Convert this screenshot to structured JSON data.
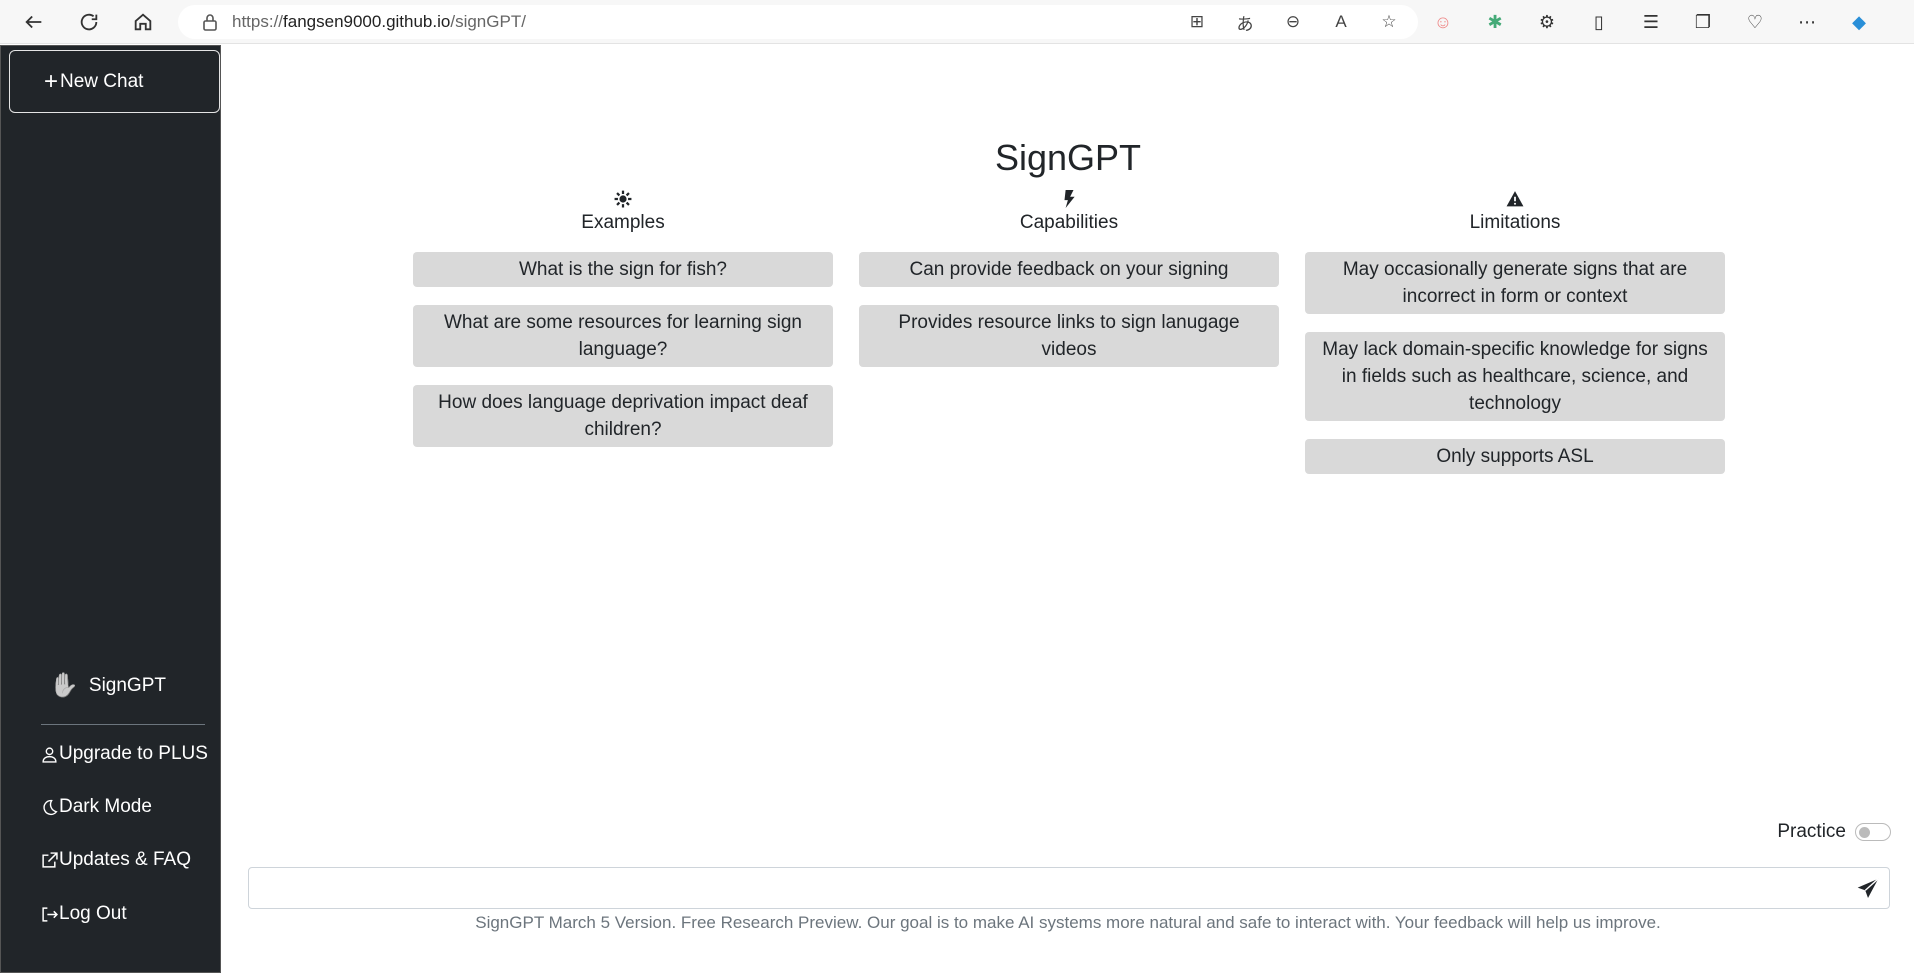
{
  "browser": {
    "url_prefix": "https://",
    "url_host": "fangsen9000.github.io",
    "url_path": "/signGPT/"
  },
  "sidebar": {
    "new_chat": "New Chat",
    "brand": "SignGPT",
    "items": [
      {
        "label": "Upgrade to PLUS",
        "icon": "person-icon"
      },
      {
        "label": "Dark Mode",
        "icon": "moon-icon"
      },
      {
        "label": "Updates & FAQ",
        "icon": "external-link-icon"
      },
      {
        "label": "Log Out",
        "icon": "logout-icon"
      }
    ]
  },
  "main": {
    "title": "SignGPT",
    "columns": [
      {
        "heading": "Examples",
        "icon": "sun-icon",
        "cards": [
          "What is the sign for fish?",
          "What are some resources for learning sign language?",
          "How does language deprivation impact deaf children?"
        ]
      },
      {
        "heading": "Capabilities",
        "icon": "lightning-icon",
        "cards": [
          "Can provide feedback on your signing",
          "Provides resource links to sign lanugage videos"
        ]
      },
      {
        "heading": "Limitations",
        "icon": "warning-icon",
        "cards": [
          "May occasionally generate signs that are incorrect in form or context",
          "May lack domain-specific knowledge for signs in fields such as healthcare, science, and technology",
          "Only supports ASL"
        ]
      }
    ],
    "practice_label": "Practice",
    "input_value": "",
    "footer": "SignGPT March 5 Version. Free Research Preview. Our goal is to make AI systems more natural and safe to interact with. Your feedback will help us improve."
  },
  "colors": {
    "sidebar_bg": "#212529",
    "card_bg": "#d9d9d9",
    "footer_text": "#6c757d"
  }
}
